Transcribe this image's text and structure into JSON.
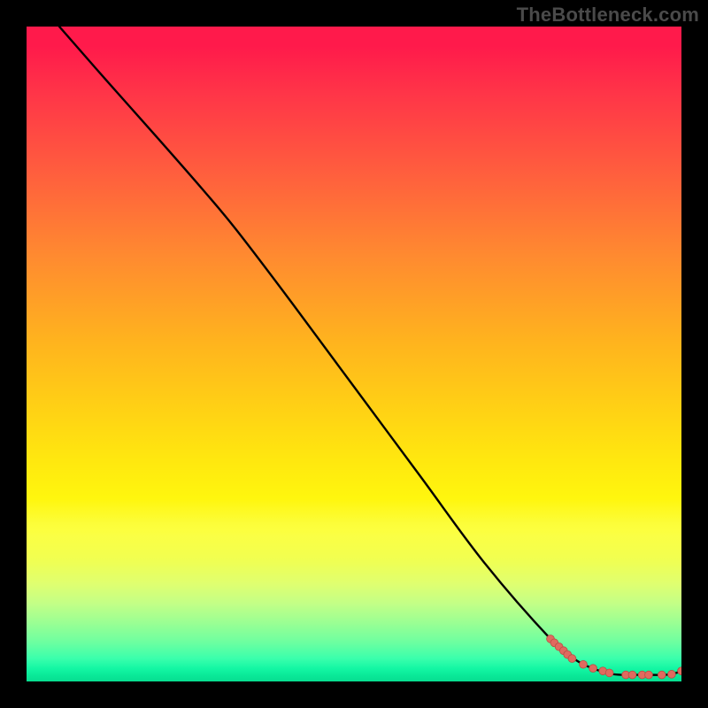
{
  "watermark": "TheBottleneck.com",
  "colors": {
    "background": "#000000",
    "curve": "#000000",
    "points_fill": "#e06a5f",
    "points_stroke": "#b94d44"
  },
  "chart_data": {
    "type": "line",
    "title": "",
    "xlabel": "",
    "ylabel": "",
    "xlim": [
      0,
      100
    ],
    "ylim": [
      0,
      100
    ],
    "axes_visible": false,
    "grid": false,
    "background": "rainbow-gradient (red top → green bottom)",
    "series": [
      {
        "name": "curve",
        "type": "line",
        "color": "#000000",
        "x": [
          5,
          12,
          20,
          27,
          32,
          40,
          50,
          60,
          70,
          80,
          84,
          87,
          89,
          91,
          93,
          95,
          97,
          98.5,
          100
        ],
        "y": [
          100,
          92,
          83,
          75,
          69,
          58.5,
          45,
          31.5,
          18,
          6.5,
          3.2,
          1.8,
          1.2,
          1.0,
          1.0,
          1.0,
          1.0,
          1.1,
          1.6
        ]
      },
      {
        "name": "points",
        "type": "scatter",
        "color": "#e06a5f",
        "x": [
          80.0,
          80.6,
          81.3,
          82.0,
          82.6,
          83.3,
          85.0,
          86.5,
          88.0,
          89.0,
          91.5,
          92.5,
          94.0,
          95.0,
          97.0,
          98.5,
          100.0
        ],
        "y": [
          6.5,
          5.9,
          5.3,
          4.7,
          4.1,
          3.5,
          2.6,
          2.0,
          1.6,
          1.3,
          1.0,
          1.0,
          1.0,
          1.0,
          1.0,
          1.1,
          1.6
        ]
      }
    ]
  }
}
